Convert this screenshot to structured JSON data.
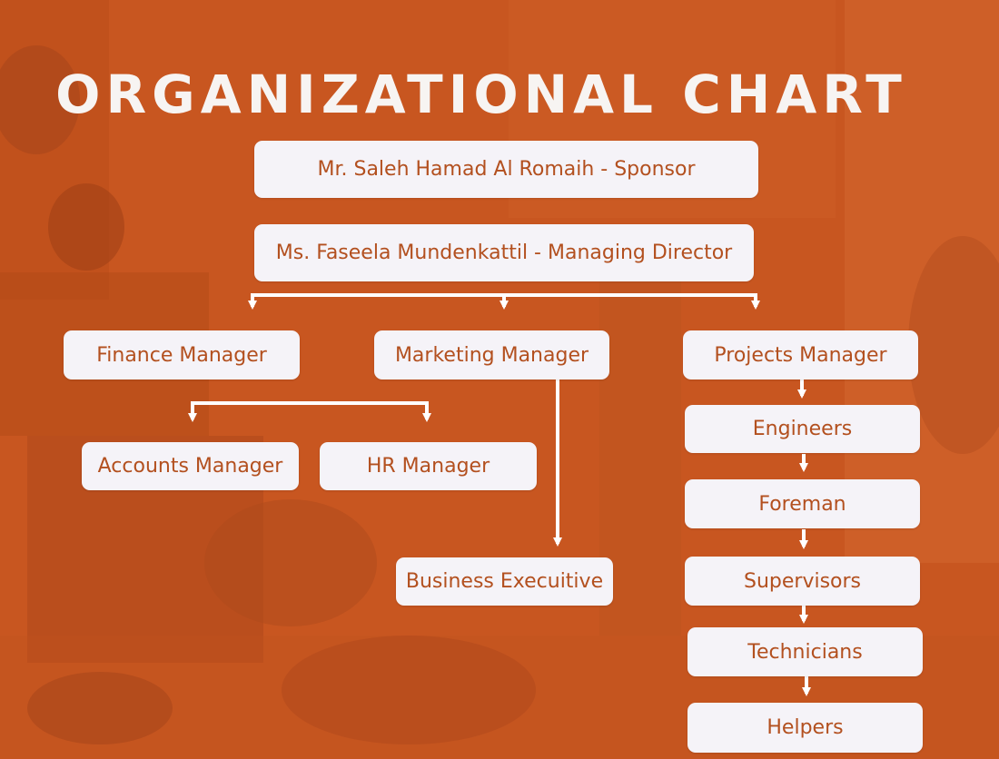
{
  "title": "ORGANIZATIONAL CHART",
  "colors": {
    "background": "#c9561f",
    "box": "#f5f3f8",
    "box_text": "#b3501f",
    "connector": "#ffffff"
  },
  "nodes": {
    "sponsor": "Mr. Saleh Hamad Al Romaih - Sponsor",
    "managing_director": "Ms. Faseela Mundenkattil - Managing Director",
    "finance_manager": "Finance Manager",
    "marketing_manager": "Marketing Manager",
    "projects_manager": "Projects Manager",
    "accounts_manager": "Accounts Manager",
    "hr_manager": "HR Manager",
    "business_executive": "Business Execuitive",
    "engineers": "Engineers",
    "foreman": "Foreman",
    "supervisors": "Supervisors",
    "technicians": "Technicians",
    "helpers": "Helpers"
  }
}
